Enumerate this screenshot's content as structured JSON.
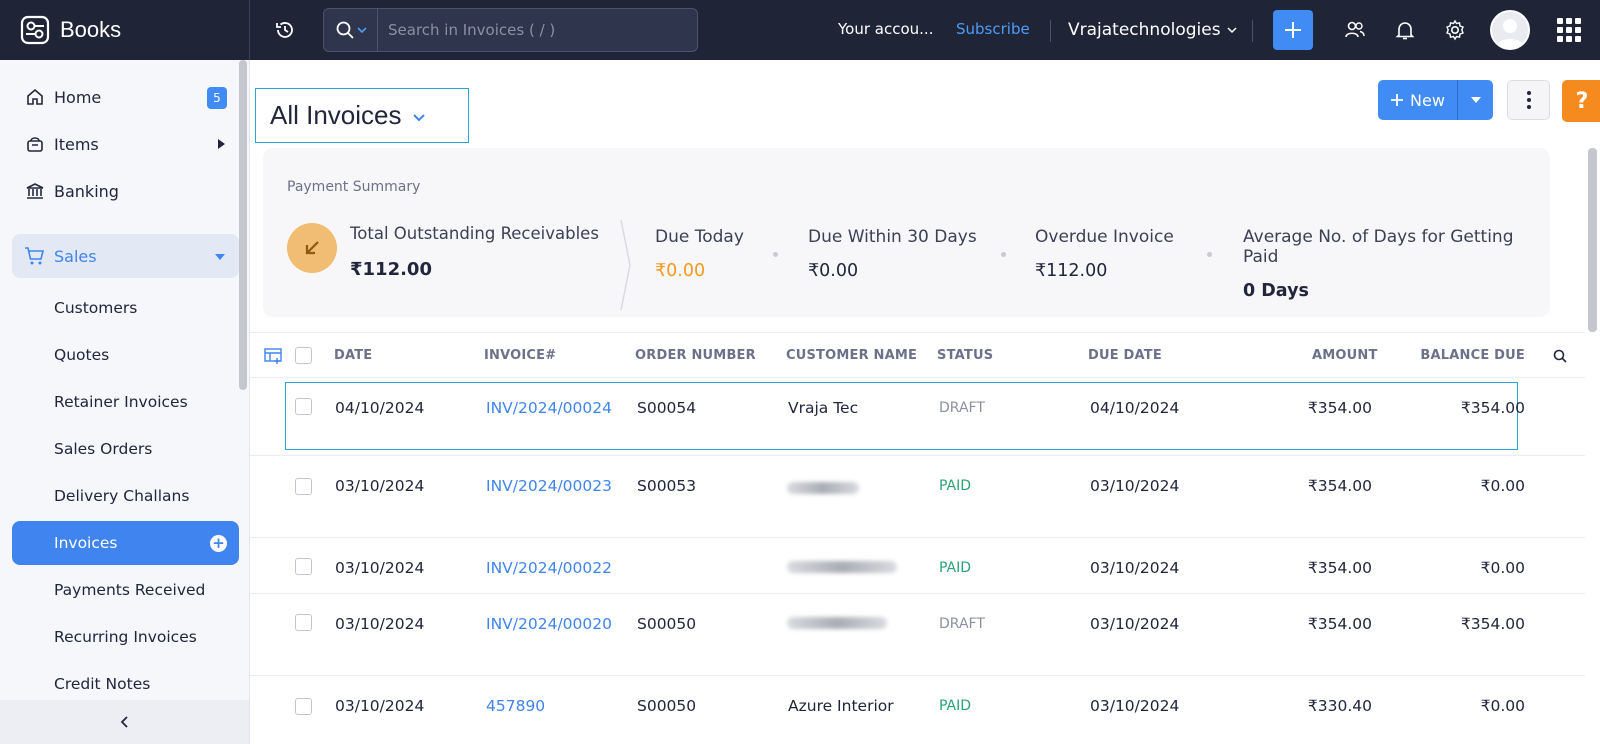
{
  "app": {
    "name": "Books",
    "search_placeholder": "Search in Invoices ( / )",
    "account_text": "Your accou...",
    "subscribe_label": "Subscribe",
    "org_name": "Vrajatechnologies"
  },
  "sidebar": {
    "home": {
      "label": "Home",
      "badge": "5"
    },
    "items": {
      "label": "Items"
    },
    "banking": {
      "label": "Banking"
    },
    "sales": {
      "label": "Sales"
    },
    "sub_items": [
      "Customers",
      "Quotes",
      "Retainer Invoices",
      "Sales Orders",
      "Delivery Challans",
      "Invoices",
      "Payments Received",
      "Recurring Invoices",
      "Credit Notes"
    ],
    "active_sub": "Invoices"
  },
  "page": {
    "title": "All Invoices",
    "new_label": "New",
    "help_label": "?"
  },
  "summary": {
    "title": "Payment Summary",
    "total_label": "Total Outstanding Receivables",
    "total_value": "₹112.00",
    "due_today_label": "Due Today",
    "due_today_value": "₹0.00",
    "due_30_label": "Due Within 30 Days",
    "due_30_value": "₹0.00",
    "overdue_label": "Overdue Invoice",
    "overdue_value": "₹112.00",
    "avg_label": "Average No. of Days for Getting Paid",
    "avg_value": "0 Days"
  },
  "table": {
    "headers": {
      "date": "DATE",
      "invoice": "INVOICE#",
      "order": "ORDER NUMBER",
      "customer": "CUSTOMER NAME",
      "status": "STATUS",
      "due": "DUE DATE",
      "amount": "AMOUNT",
      "balance": "BALANCE DUE"
    },
    "rows": [
      {
        "date": "04/10/2024",
        "invoice": "INV/2024/00024",
        "order": "S00054",
        "customer": "Vraja Tec",
        "status": "DRAFT",
        "due": "04/10/2024",
        "amount": "₹354.00",
        "balance": "₹354.00"
      },
      {
        "date": "03/10/2024",
        "invoice": "INV/2024/00023",
        "order": "S00053",
        "customer": "",
        "status": "PAID",
        "due": "03/10/2024",
        "amount": "₹354.00",
        "balance": "₹0.00"
      },
      {
        "date": "03/10/2024",
        "invoice": "INV/2024/00022",
        "order": "",
        "customer": "",
        "status": "PAID",
        "due": "03/10/2024",
        "amount": "₹354.00",
        "balance": "₹0.00"
      },
      {
        "date": "03/10/2024",
        "invoice": "INV/2024/00020",
        "order": "S00050",
        "customer": "",
        "status": "DRAFT",
        "due": "03/10/2024",
        "amount": "₹354.00",
        "balance": "₹354.00"
      },
      {
        "date": "03/10/2024",
        "invoice": "457890",
        "order": "S00050",
        "customer": "Azure Interior",
        "status": "PAID",
        "due": "03/10/2024",
        "amount": "₹330.40",
        "balance": "₹0.00"
      }
    ]
  },
  "colors": {
    "topbar": "#1f2537",
    "accent": "#418bf5",
    "paid": "#2aa375",
    "draft": "#8b90a3",
    "due_today": "#f39a1e",
    "help": "#f58b1f"
  }
}
